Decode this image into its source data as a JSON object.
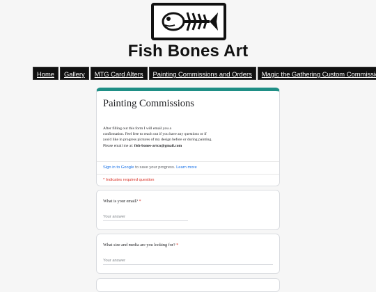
{
  "site": {
    "title": "Fish Bones Art",
    "logo_icon": "fish-skeleton-icon"
  },
  "nav": [
    {
      "label": "Home"
    },
    {
      "label": "Gallery"
    },
    {
      "label": "MTG Card Alters"
    },
    {
      "label": "Painting Commissions and Orders"
    },
    {
      "label": "Magic the Gathering Custom Commissions"
    }
  ],
  "form": {
    "title": "Painting Commissions",
    "description_lines": [
      "After filling out this form I will email you a",
      "confirmation. Feel free to reach out if you have any questions or if",
      "you'd like in progress pictures of my design before or during painting.",
      "Please email me at: "
    ],
    "email": "fish-bones-artco@gmail.com",
    "signin_link": "Sign in to Google",
    "signin_text": " to save your progress. ",
    "learn_more": "Learn more",
    "required_note": "* Indicates required question",
    "accent_color": "#1f8f86",
    "questions": [
      {
        "label": "What is your email?",
        "required": "*",
        "placeholder": "Your answer"
      },
      {
        "label": "What size and media are you looking for?",
        "required": "*",
        "placeholder": "Your answer"
      }
    ]
  }
}
